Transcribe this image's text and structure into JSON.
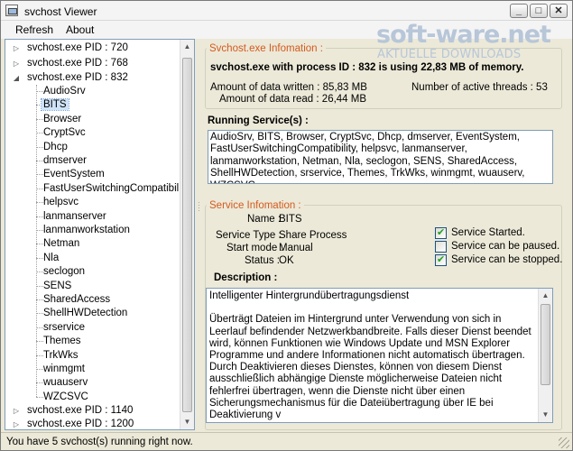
{
  "window": {
    "title": "svchost Viewer",
    "minimize": "_",
    "maximize": "□",
    "close": "✕"
  },
  "menu": {
    "refresh": "Refresh",
    "about": "About"
  },
  "logo": {
    "main": "soft-ware.net",
    "sub": "AKTUELLE DOWNLOADS"
  },
  "tree": {
    "processes": [
      {
        "label": "svchost.exe  PID : 720",
        "expanded": false
      },
      {
        "label": "svchost.exe  PID : 768",
        "expanded": false
      },
      {
        "label": "svchost.exe  PID : 832",
        "expanded": true
      },
      {
        "label": "svchost.exe  PID : 1140",
        "expanded": false
      },
      {
        "label": "svchost.exe  PID : 1200",
        "expanded": false
      }
    ],
    "children": [
      "AudioSrv",
      "BITS",
      "Browser",
      "CryptSvc",
      "Dhcp",
      "dmserver",
      "EventSystem",
      "FastUserSwitchingCompatibility",
      "helpsvc",
      "lanmanserver",
      "lanmanworkstation",
      "Netman",
      "Nla",
      "seclogon",
      "SENS",
      "SharedAccess",
      "ShellHWDetection",
      "srservice",
      "Themes",
      "TrkWks",
      "winmgmt",
      "wuauserv",
      "WZCSVC"
    ],
    "selected": "BITS"
  },
  "svchost_info": {
    "group_title": "Svchost.exe Infomation :",
    "headline": "svchost.exe with process ID : 832 is using 22,83 MB of memory.",
    "written_label": "Amount of data written : 85,83 MB",
    "read_label": "Amount of data read : 26,44 MB",
    "threads_label": "Number of active threads : 53"
  },
  "running_services": {
    "title": "Running Service(s) :",
    "text": "AudioSrv, BITS, Browser, CryptSvc, Dhcp, dmserver, EventSystem, FastUserSwitchingCompatibility, helpsvc, lanmanserver, lanmanworkstation, Netman, Nla, seclogon, SENS, SharedAccess, ShellHWDetection, srservice, Themes, TrkWks, winmgmt, wuauserv, WZCSVC,"
  },
  "service_info": {
    "group_title": "Service Infomation :",
    "name_label": "Name :",
    "name_value": "BITS",
    "type_label": "Service Type :",
    "type_value": "Share Process",
    "start_label": "Start mode :",
    "start_value": "Manual",
    "status_label": "Status :",
    "status_value": "OK",
    "checks": [
      {
        "label": "Service Started.",
        "checked": true
      },
      {
        "label": "Service can be paused.",
        "checked": false
      },
      {
        "label": "Service can be stopped.",
        "checked": true
      }
    ],
    "description_title": "Description :",
    "description": "Intelligenter Hintergrundübertragungsdienst\n\nÜberträgt Dateien im Hintergrund unter Verwendung von sich in Leerlauf befindender Netzwerkbandbreite. Falls dieser Dienst beendet wird, können Funktionen wie Windows Update und MSN Explorer Programme und andere Informationen nicht automatisch übertragen. Durch Deaktivieren dieses Dienstes, können von diesem Dienst ausschließlich abhängige Dienste möglicherweise Dateien nicht fehlerfrei übertragen, wenn die Dienste nicht über einen Sicherungsmechanismus für die Dateiübertragung über IE bei Deaktivierung v\n\nProgram path :"
  },
  "status": {
    "text": "You have 5 svchost(s) running right now."
  }
}
